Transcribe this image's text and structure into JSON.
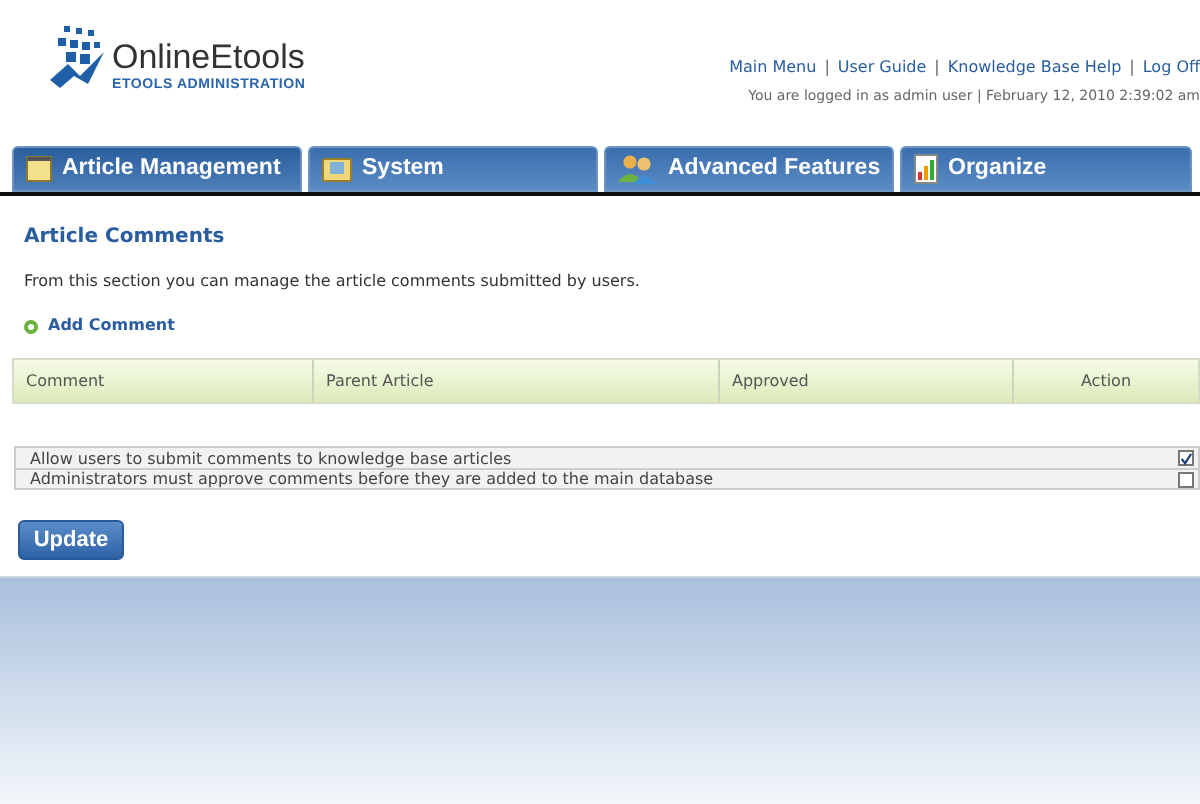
{
  "logo": {
    "name": "OnlineEtools",
    "subtitle": "ETOOLS ADMINISTRATION"
  },
  "header_links": [
    "Main Menu",
    "User Guide",
    "Knowledge Base Help",
    "Log Off"
  ],
  "link_separator": "|",
  "login_info": "You are logged in as admin user | February 12, 2010 2:39:02 am",
  "tabs": [
    {
      "label": "Article Management",
      "kind": "notes",
      "selected": true
    },
    {
      "label": "System",
      "kind": "folder",
      "selected": false
    },
    {
      "label": "Advanced Features",
      "kind": "users",
      "selected": false
    },
    {
      "label": "Organize",
      "kind": "chart",
      "selected": false
    }
  ],
  "section": {
    "title": "Article Comments",
    "description": "From this section you can manage the article comments submitted by users.",
    "add_link": "Add Comment"
  },
  "table": {
    "columns": [
      "Comment",
      "Parent Article",
      "Approved",
      "Action"
    ]
  },
  "settings": [
    {
      "label": "Allow users to submit comments to knowledge base articles",
      "checked": true
    },
    {
      "label": "Administrators must approve comments before they are added to the main database",
      "checked": false
    }
  ],
  "update_button": "Update"
}
